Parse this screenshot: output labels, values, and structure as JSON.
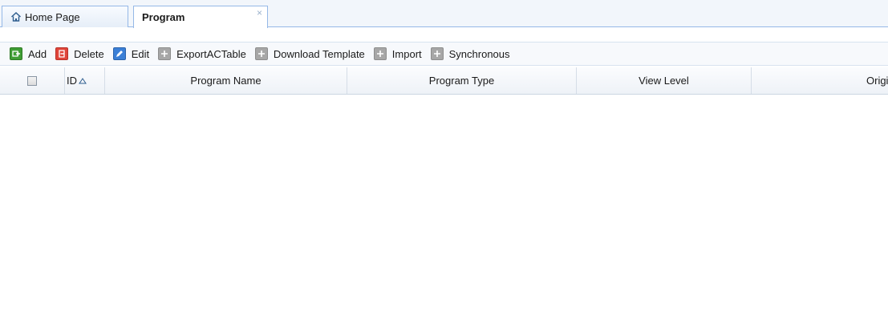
{
  "tabs": [
    {
      "label": "Home Page",
      "icon": "home-icon",
      "active": false
    },
    {
      "label": "Program",
      "icon": "",
      "active": true,
      "close_glyph": "×"
    }
  ],
  "toolbar": {
    "buttons": [
      {
        "label": "Add",
        "icon": "add-icon",
        "color": "#3f9d34"
      },
      {
        "label": "Delete",
        "icon": "delete-icon",
        "color": "#e0453a"
      },
      {
        "label": "Edit",
        "icon": "edit-icon",
        "color": "#3b7fd6"
      },
      {
        "label": "ExportACTable",
        "icon": "export-icon",
        "color": "#a7a7a7"
      },
      {
        "label": "Download Template",
        "icon": "download-icon",
        "color": "#a7a7a7"
      },
      {
        "label": "Import",
        "icon": "import-icon",
        "color": "#a7a7a7"
      },
      {
        "label": "Synchronous",
        "icon": "sync-icon",
        "color": "#a7a7a7"
      }
    ]
  },
  "grid": {
    "columns": [
      "ID",
      "Program Name",
      "Program Type",
      "View Level",
      "Origina"
    ],
    "sort_column": "ID",
    "sort_direction": "ascending",
    "rows": []
  },
  "colors": {
    "tab_border": "#95b8e7",
    "header_bg": "#eef2f7"
  }
}
